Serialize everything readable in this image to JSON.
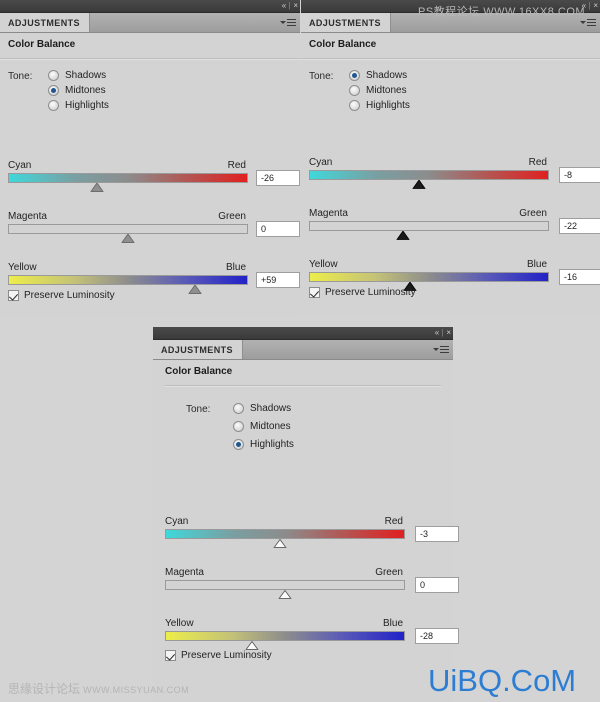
{
  "app": {
    "panel_tab_label": "ADJUSTMENTS",
    "adjustment_title": "Color Balance",
    "tone_label": "Tone:",
    "preserve_label": "Preserve Luminosity",
    "titlebar_collapse_icon": "«",
    "titlebar_separator": "|",
    "titlebar_close_icon": "×",
    "accent_color": "#20578c"
  },
  "slider_labels": {
    "cyan": "Cyan",
    "red": "Red",
    "magenta": "Magenta",
    "green": "Green",
    "yellow": "Yellow",
    "blue": "Blue"
  },
  "tone_options": [
    {
      "label": "Shadows"
    },
    {
      "label": "Midtones"
    },
    {
      "label": "Highlights"
    }
  ],
  "panels": [
    {
      "id": "panel-midtones",
      "tab_label": "ADJUSTMENTS",
      "title": "Color Balance",
      "selected_tone": "Midtones",
      "selected_index": 1,
      "handle_style": "gray",
      "preserve_luminosity": true,
      "sliders": [
        {
          "name": "cyan-red",
          "left_label": "Cyan",
          "right_label": "Red",
          "value": "-26",
          "percent": 37
        },
        {
          "name": "magenta-green",
          "left_label": "Magenta",
          "right_label": "Green",
          "value": "0",
          "percent": 50
        },
        {
          "name": "yellow-blue",
          "left_label": "Yellow",
          "right_label": "Blue",
          "value": "+59",
          "percent": 78
        }
      ]
    },
    {
      "id": "panel-shadows",
      "tab_label": "ADJUSTMENTS",
      "title": "Color Balance",
      "selected_tone": "Shadows",
      "selected_index": 0,
      "handle_style": "dark",
      "preserve_luminosity": true,
      "sliders": [
        {
          "name": "cyan-red",
          "left_label": "Cyan",
          "right_label": "Red",
          "value": "-8",
          "percent": 46
        },
        {
          "name": "magenta-green",
          "left_label": "Magenta",
          "right_label": "Green",
          "value": "-22",
          "percent": 39
        },
        {
          "name": "yellow-blue",
          "left_label": "Yellow",
          "right_label": "Blue",
          "value": "-16",
          "percent": 42
        }
      ]
    },
    {
      "id": "panel-highlights",
      "tab_label": "ADJUSTMENTS",
      "title": "Color Balance",
      "selected_tone": "Highlights",
      "selected_index": 2,
      "handle_style": "light",
      "preserve_luminosity": true,
      "sliders": [
        {
          "name": "cyan-red",
          "left_label": "Cyan",
          "right_label": "Red",
          "value": "-3",
          "percent": 48
        },
        {
          "name": "magenta-green",
          "left_label": "Magenta",
          "right_label": "Green",
          "value": "0",
          "percent": 50
        },
        {
          "name": "yellow-blue",
          "left_label": "Yellow",
          "right_label": "Blue",
          "value": "-28",
          "percent": 36
        }
      ]
    }
  ],
  "watermarks": {
    "top_right": "PS教程论坛  WWW.16XX8.COM",
    "bottom_left_cn": "思缘设计论坛",
    "bottom_left_url": "WWW.MISSYUAN.COM",
    "bottom_right": "UiBQ.CoM"
  }
}
